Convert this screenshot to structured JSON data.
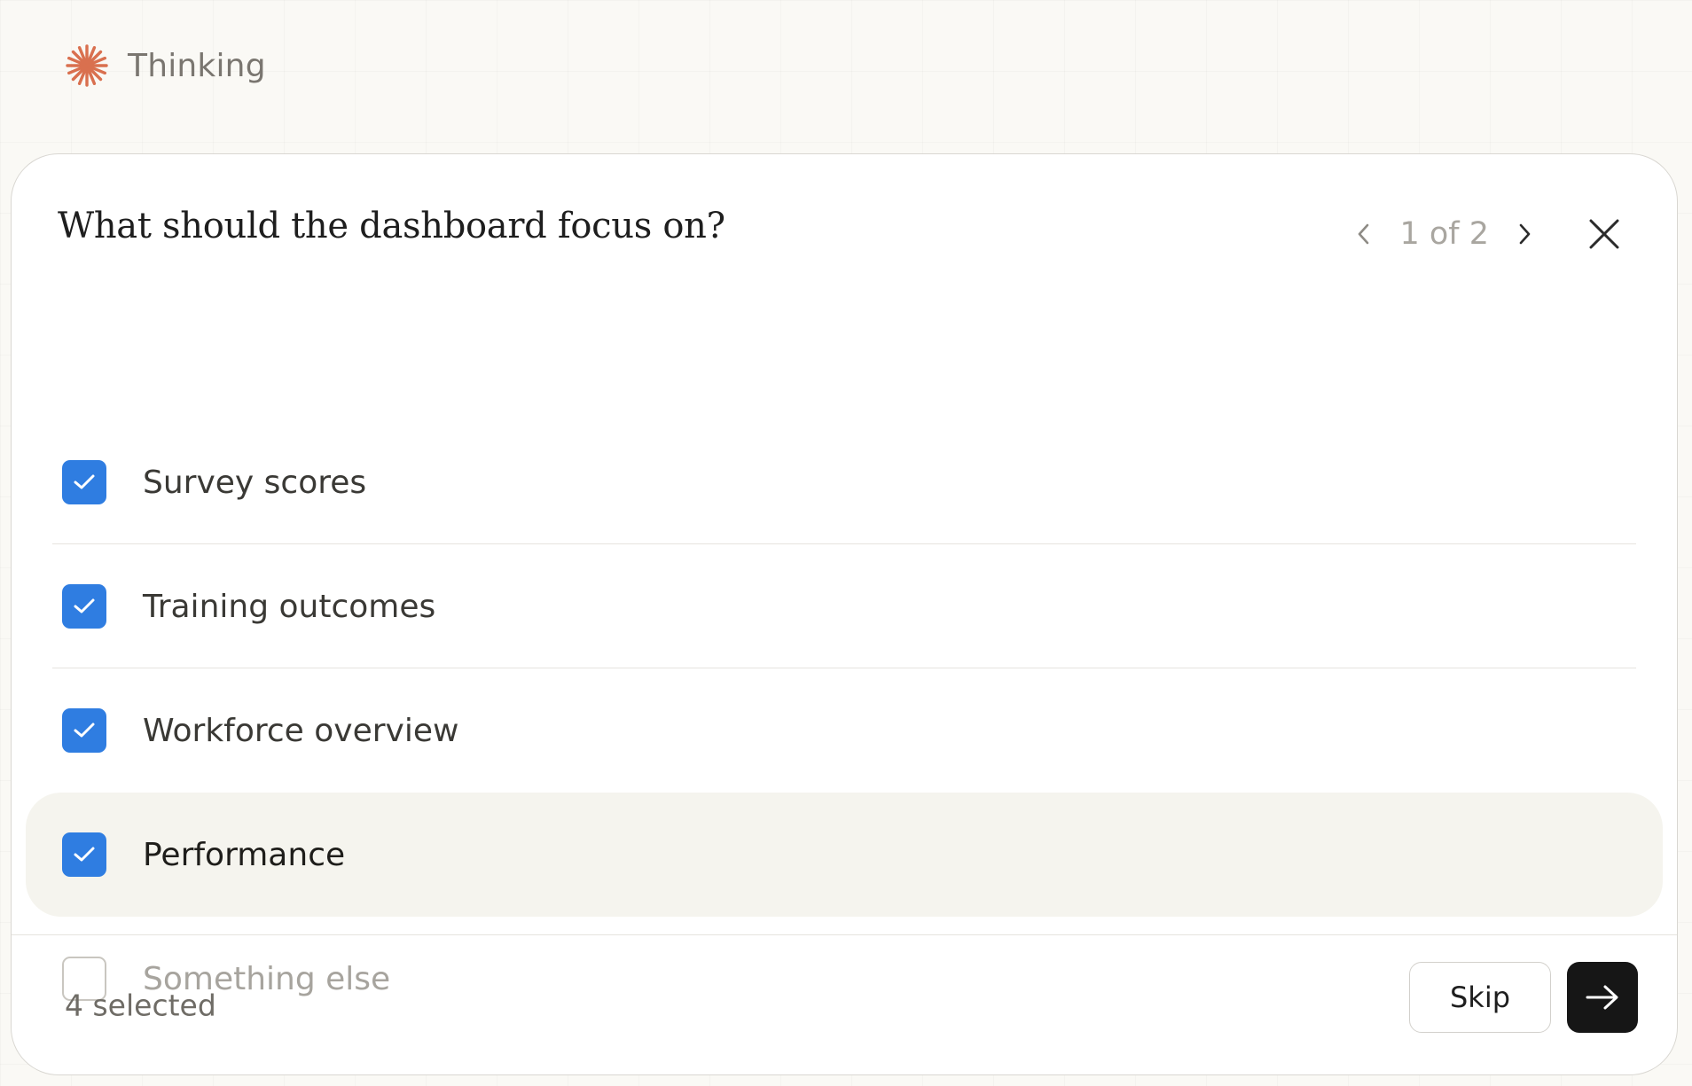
{
  "status": {
    "label": "Thinking",
    "icon": "sparkle-asterisk-icon",
    "icon_color": "#d9704f"
  },
  "question": {
    "title": "What should the dashboard focus on?",
    "pager": {
      "text": "1 of 2",
      "current": 1,
      "total": 2
    }
  },
  "options": [
    {
      "label": "Survey scores",
      "checked": true
    },
    {
      "label": "Training outcomes",
      "checked": true
    },
    {
      "label": "Workforce overview",
      "checked": true
    },
    {
      "label": "Performance",
      "checked": true,
      "hovered": true
    },
    {
      "label": "Something else",
      "checked": false,
      "placeholder": true
    }
  ],
  "footer": {
    "selected_text": "4 selected",
    "skip_label": "Skip",
    "next_icon": "arrow-right-icon"
  },
  "colors": {
    "checkbox_checked": "#2f7de1",
    "primary_button": "#161616",
    "hover_row": "#f5f4ee",
    "background": "#faf9f5"
  }
}
